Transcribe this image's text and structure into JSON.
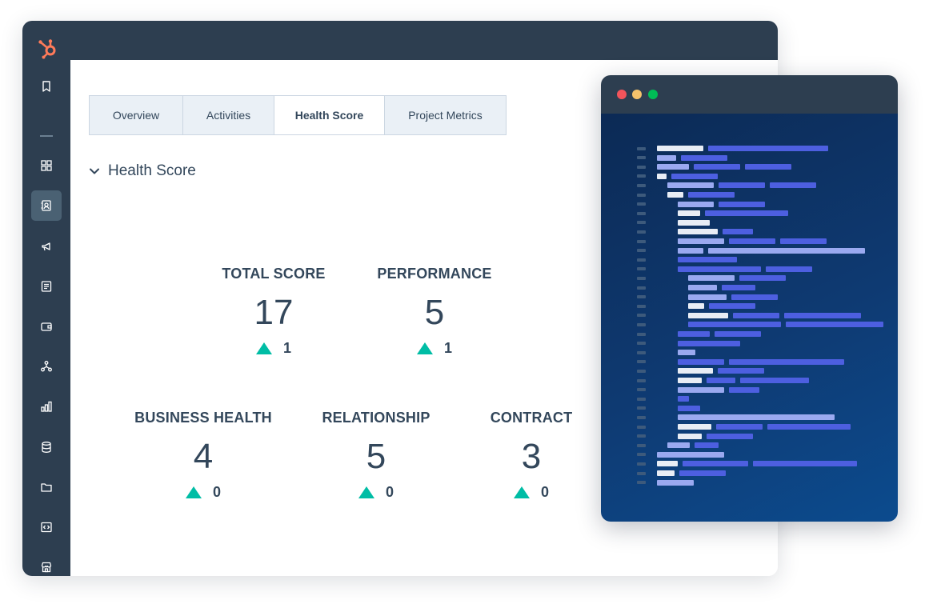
{
  "nav": {
    "items": [
      {
        "name": "bookmark-icon",
        "active": false
      },
      {
        "name": "dashboard-icon",
        "active": false
      },
      {
        "name": "contacts-icon",
        "active": true
      },
      {
        "name": "megaphone-icon",
        "active": false
      },
      {
        "name": "documents-icon",
        "active": false
      },
      {
        "name": "wallet-icon",
        "active": false
      },
      {
        "name": "workflow-icon",
        "active": false
      },
      {
        "name": "reports-icon",
        "active": false
      },
      {
        "name": "database-icon",
        "active": false
      },
      {
        "name": "folder-icon",
        "active": false
      },
      {
        "name": "code-icon",
        "active": false
      },
      {
        "name": "marketplace-icon",
        "active": false
      }
    ]
  },
  "tabs": [
    {
      "label": "Overview",
      "active": false
    },
    {
      "label": "Activities",
      "active": false
    },
    {
      "label": "Health Score",
      "active": true
    },
    {
      "label": "Project Metrics",
      "active": false
    }
  ],
  "section": {
    "title": "Health Score"
  },
  "metrics": {
    "total_score": {
      "label": "TOTAL SCORE",
      "value": "17",
      "change": "1"
    },
    "performance": {
      "label": "PERFORMANCE",
      "value": "5",
      "change": "1"
    },
    "business_health": {
      "label": "BUSINESS HEALTH",
      "value": "4",
      "change": "0"
    },
    "relationship": {
      "label": "RELATIONSHIP",
      "value": "5",
      "change": "0"
    },
    "contract": {
      "label": "CONTRACT",
      "value": "3",
      "change": "0"
    }
  },
  "colors": {
    "sidebar": "#2d3e50",
    "accent_teal": "#00bda5",
    "logo_orange": "#ff7a59",
    "text_dark": "#33475b",
    "tab_inactive": "#eaf0f6",
    "window_dot_red": "#f2545b",
    "window_dot_yellow": "#f5c26b",
    "window_dot_green": "#00bd56"
  }
}
